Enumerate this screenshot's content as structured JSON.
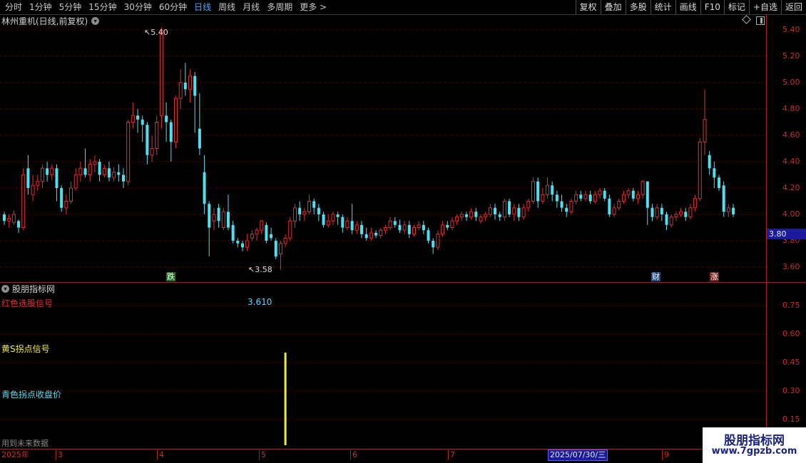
{
  "toolbar": {
    "periods": [
      "分时",
      "1分钟",
      "5分钟",
      "15分钟",
      "30分钟",
      "60分钟",
      "日线",
      "周线",
      "月线",
      "多周期",
      "更多 >"
    ],
    "active_period": "日线",
    "right_buttons": [
      "复权",
      "叠加",
      "多股",
      "统计",
      "画线",
      "F10",
      "标记",
      "+自选",
      "返回"
    ]
  },
  "main": {
    "title": "林州重机(日线,前复权)",
    "price_axis": [
      "5.40",
      "5.20",
      "5.00",
      "4.80",
      "4.60",
      "4.40",
      "4.20",
      "4.00",
      "3.80",
      "3.60"
    ],
    "current_price": "3.80",
    "high_label": "5.40",
    "low_label": "3.58",
    "markers": {
      "die": "跌",
      "cai": "财",
      "zhang": "涨"
    }
  },
  "indicator": {
    "name": "股朋指标网",
    "signal_red": "红色选股信号",
    "signal_red_value": "3.610",
    "signal_yellow": "黄S拐点信号",
    "signal_cyan": "青色拐点收盘价",
    "future_note": "用到未来数据",
    "axis": [
      "0.75",
      "0.60",
      "0.45",
      "0.30",
      "0.15"
    ]
  },
  "date_axis": {
    "year": "2025年",
    "months": [
      "3",
      "4",
      "5",
      "6",
      "7",
      "9"
    ],
    "current_date": "2025/07/30/三"
  },
  "watermark": {
    "title": "股朋指标网",
    "url": "www.7gpzb.com"
  },
  "colors": {
    "up": "#e03030",
    "down": "#4fe0f0",
    "grid": "#7a1010",
    "axis": "#c83030",
    "signal": "#f0f020"
  },
  "chart_data": {
    "type": "candlestick",
    "price_range": [
      3.5,
      5.45
    ],
    "candles": [
      [
        4.0,
        3.95,
        4.02,
        3.92
      ],
      [
        3.95,
        3.97,
        4.0,
        3.9
      ],
      [
        3.94,
        4.0,
        4.03,
        3.92
      ],
      [
        3.95,
        3.9,
        3.96,
        3.86
      ],
      [
        3.9,
        4.3,
        4.35,
        3.88
      ],
      [
        4.35,
        4.2,
        4.45,
        4.15
      ],
      [
        4.15,
        4.22,
        4.3,
        4.1
      ],
      [
        4.22,
        4.25,
        4.3,
        4.18
      ],
      [
        4.25,
        4.35,
        4.38,
        4.2
      ],
      [
        4.35,
        4.3,
        4.4,
        4.25
      ],
      [
        4.3,
        4.35,
        4.38,
        4.26
      ],
      [
        4.35,
        4.2,
        4.38,
        4.1
      ],
      [
        4.2,
        4.05,
        4.22,
        4.02
      ],
      [
        4.05,
        4.1,
        4.15,
        4.0
      ],
      [
        4.1,
        4.2,
        4.25,
        4.08
      ],
      [
        4.2,
        4.3,
        4.35,
        4.18
      ],
      [
        4.3,
        4.35,
        4.4,
        4.25
      ],
      [
        4.35,
        4.3,
        4.5,
        4.28
      ],
      [
        4.3,
        4.38,
        4.42,
        4.25
      ],
      [
        4.38,
        4.4,
        4.45,
        4.32
      ],
      [
        4.4,
        4.3,
        4.42,
        4.25
      ],
      [
        4.3,
        4.35,
        4.38,
        4.28
      ],
      [
        4.35,
        4.28,
        4.4,
        4.25
      ],
      [
        4.28,
        4.32,
        4.36,
        4.25
      ],
      [
        4.32,
        4.3,
        4.38,
        4.25
      ],
      [
        4.3,
        4.25,
        4.35,
        4.2
      ],
      [
        4.25,
        4.7,
        4.72,
        4.22
      ],
      [
        4.7,
        4.75,
        4.85,
        4.65
      ],
      [
        4.75,
        4.72,
        4.8,
        4.62
      ],
      [
        4.72,
        4.68,
        4.75,
        4.55
      ],
      [
        4.68,
        4.45,
        4.7,
        4.38
      ],
      [
        4.45,
        4.5,
        4.6,
        4.4
      ],
      [
        4.5,
        4.7,
        4.75,
        4.45
      ],
      [
        4.75,
        5.4,
        5.42,
        4.65
      ],
      [
        4.75,
        4.7,
        4.85,
        4.55
      ],
      [
        4.7,
        4.55,
        4.72,
        4.4
      ],
      [
        4.55,
        4.88,
        4.9,
        4.5
      ],
      [
        4.88,
        5.0,
        5.1,
        4.8
      ],
      [
        5.0,
        4.95,
        5.15,
        4.9
      ],
      [
        4.95,
        5.05,
        5.1,
        4.85
      ],
      [
        5.05,
        4.9,
        5.08,
        4.62
      ],
      [
        4.65,
        4.5,
        4.92,
        4.45
      ],
      [
        4.32,
        4.08,
        4.45,
        4.0
      ],
      [
        4.08,
        3.9,
        4.1,
        3.68
      ],
      [
        3.95,
        4.0,
        4.05,
        3.88
      ],
      [
        4.05,
        3.95,
        4.08,
        3.9
      ],
      [
        3.9,
        4.02,
        4.05,
        3.88
      ],
      [
        4.02,
        3.9,
        4.15,
        3.88
      ],
      [
        3.92,
        3.8,
        3.95,
        3.78
      ],
      [
        3.8,
        3.78,
        3.82,
        3.75
      ],
      [
        3.78,
        3.75,
        3.8,
        3.72
      ],
      [
        3.75,
        3.8,
        3.85,
        3.72
      ],
      [
        3.82,
        3.85,
        3.88,
        3.8
      ],
      [
        3.85,
        3.88,
        3.9,
        3.8
      ],
      [
        3.88,
        3.95,
        3.96,
        3.85
      ],
      [
        3.92,
        3.8,
        3.94,
        3.78
      ],
      [
        3.85,
        3.82,
        3.9,
        3.8
      ],
      [
        3.8,
        3.68,
        3.82,
        3.66
      ],
      [
        3.7,
        3.78,
        3.8,
        3.58
      ],
      [
        3.78,
        3.82,
        3.85,
        3.75
      ],
      [
        3.82,
        3.95,
        3.98,
        3.8
      ],
      [
        3.95,
        4.05,
        4.08,
        3.9
      ],
      [
        4.05,
        4.0,
        4.1,
        3.95
      ],
      [
        4.0,
        4.02,
        4.05,
        3.95
      ],
      [
        4.02,
        4.1,
        4.15,
        4.0
      ],
      [
        4.1,
        4.05,
        4.12,
        4.0
      ],
      [
        4.05,
        4.0,
        4.08,
        3.95
      ],
      [
        4.0,
        3.92,
        4.02,
        3.9
      ],
      [
        3.92,
        3.95,
        4.0,
        3.9
      ],
      [
        3.95,
        4.0,
        4.02,
        3.92
      ],
      [
        4.0,
        3.98,
        4.02,
        3.92
      ],
      [
        3.98,
        3.9,
        4.0,
        3.86
      ],
      [
        3.9,
        3.95,
        3.98,
        3.88
      ],
      [
        3.95,
        3.88,
        4.08,
        3.85
      ],
      [
        3.88,
        3.92,
        3.95,
        3.85
      ],
      [
        3.92,
        3.85,
        3.95,
        3.82
      ],
      [
        3.85,
        3.82,
        3.9,
        3.8
      ],
      [
        3.82,
        3.86,
        3.9,
        3.8
      ],
      [
        3.86,
        3.84,
        3.88,
        3.82
      ],
      [
        3.84,
        3.88,
        3.9,
        3.82
      ],
      [
        3.88,
        3.9,
        3.92,
        3.85
      ],
      [
        3.9,
        3.95,
        3.98,
        3.88
      ],
      [
        3.95,
        3.92,
        3.98,
        3.9
      ],
      [
        3.92,
        3.88,
        3.96,
        3.86
      ],
      [
        3.88,
        3.92,
        3.95,
        3.85
      ],
      [
        3.92,
        3.85,
        3.95,
        3.82
      ],
      [
        3.85,
        3.9,
        3.92,
        3.83
      ],
      [
        3.9,
        3.92,
        3.95,
        3.88
      ],
      [
        3.92,
        3.88,
        3.95,
        3.85
      ],
      [
        3.88,
        3.8,
        3.9,
        3.78
      ],
      [
        3.8,
        3.75,
        3.82,
        3.7
      ],
      [
        3.75,
        3.85,
        3.88,
        3.73
      ],
      [
        3.85,
        3.92,
        3.95,
        3.83
      ],
      [
        3.92,
        3.9,
        3.95,
        3.88
      ],
      [
        3.9,
        3.95,
        3.98,
        3.88
      ],
      [
        3.95,
        3.98,
        4.0,
        3.92
      ],
      [
        3.98,
        4.0,
        4.02,
        3.95
      ],
      [
        4.0,
        3.98,
        4.02,
        3.95
      ],
      [
        3.98,
        4.02,
        4.05,
        3.96
      ],
      [
        4.02,
        3.98,
        4.05,
        3.95
      ],
      [
        3.95,
        3.98,
        4.0,
        3.93
      ],
      [
        3.98,
        4.0,
        4.02,
        3.95
      ],
      [
        4.0,
        4.05,
        4.08,
        3.98
      ],
      [
        4.05,
        4.0,
        4.08,
        3.96
      ],
      [
        4.0,
        3.98,
        4.02,
        3.95
      ],
      [
        3.98,
        4.1,
        4.12,
        3.95
      ],
      [
        4.1,
        4.0,
        4.12,
        3.98
      ],
      [
        4.0,
        4.05,
        4.08,
        3.95
      ],
      [
        4.05,
        3.98,
        4.08,
        3.95
      ],
      [
        3.98,
        4.05,
        4.08,
        3.96
      ],
      [
        4.05,
        4.1,
        4.12,
        4.02
      ],
      [
        4.1,
        4.25,
        4.28,
        4.08
      ],
      [
        4.25,
        4.1,
        4.28,
        4.05
      ],
      [
        4.1,
        4.15,
        4.2,
        4.08
      ],
      [
        4.15,
        4.22,
        4.28,
        4.12
      ],
      [
        4.22,
        4.15,
        4.25,
        4.1
      ],
      [
        4.15,
        4.1,
        4.18,
        4.05
      ],
      [
        4.1,
        4.05,
        4.15,
        4.02
      ],
      [
        4.05,
        4.02,
        4.08,
        3.98
      ],
      [
        4.02,
        4.1,
        4.12,
        4.0
      ],
      [
        4.1,
        4.15,
        4.18,
        4.08
      ],
      [
        4.15,
        4.12,
        4.18,
        4.1
      ],
      [
        4.12,
        4.15,
        4.18,
        4.1
      ],
      [
        4.15,
        4.1,
        4.18,
        4.08
      ],
      [
        4.1,
        4.15,
        4.18,
        4.08
      ],
      [
        4.15,
        4.18,
        4.2,
        4.12
      ],
      [
        4.18,
        4.12,
        4.2,
        4.1
      ],
      [
        4.12,
        4.0,
        4.15,
        3.98
      ],
      [
        4.0,
        4.05,
        4.08,
        3.98
      ],
      [
        4.05,
        4.1,
        4.12,
        4.03
      ],
      [
        4.1,
        4.15,
        4.18,
        4.08
      ],
      [
        4.15,
        4.18,
        4.2,
        4.12
      ],
      [
        4.18,
        4.12,
        4.2,
        4.1
      ],
      [
        4.12,
        4.15,
        4.18,
        4.08
      ],
      [
        4.15,
        4.25,
        4.26,
        4.12
      ],
      [
        4.25,
        4.05,
        4.25,
        3.92
      ],
      [
        4.05,
        3.98,
        4.08,
        3.95
      ],
      [
        3.98,
        4.05,
        4.08,
        3.96
      ],
      [
        4.05,
        4.0,
        4.08,
        3.95
      ],
      [
        4.0,
        3.92,
        4.02,
        3.88
      ],
      [
        3.92,
        3.98,
        4.0,
        3.9
      ],
      [
        3.98,
        4.0,
        4.02,
        3.95
      ],
      [
        4.0,
        4.02,
        4.05,
        3.98
      ],
      [
        4.02,
        3.98,
        4.05,
        3.95
      ],
      [
        3.98,
        4.05,
        4.08,
        3.96
      ],
      [
        4.05,
        4.12,
        4.15,
        4.02
      ],
      [
        4.12,
        4.55,
        4.58,
        4.1
      ],
      [
        4.55,
        4.72,
        4.95,
        4.45
      ],
      [
        4.45,
        4.35,
        4.48,
        4.3
      ],
      [
        4.35,
        4.28,
        4.4,
        4.2
      ],
      [
        4.28,
        4.2,
        4.3,
        4.18
      ],
      [
        4.22,
        4.02,
        4.25,
        3.98
      ],
      [
        4.02,
        4.05,
        4.08,
        3.98
      ],
      [
        4.05,
        4.0,
        4.08,
        3.98
      ]
    ],
    "signal_bar_index": 59,
    "indicator_range": [
      0,
      0.9
    ]
  }
}
